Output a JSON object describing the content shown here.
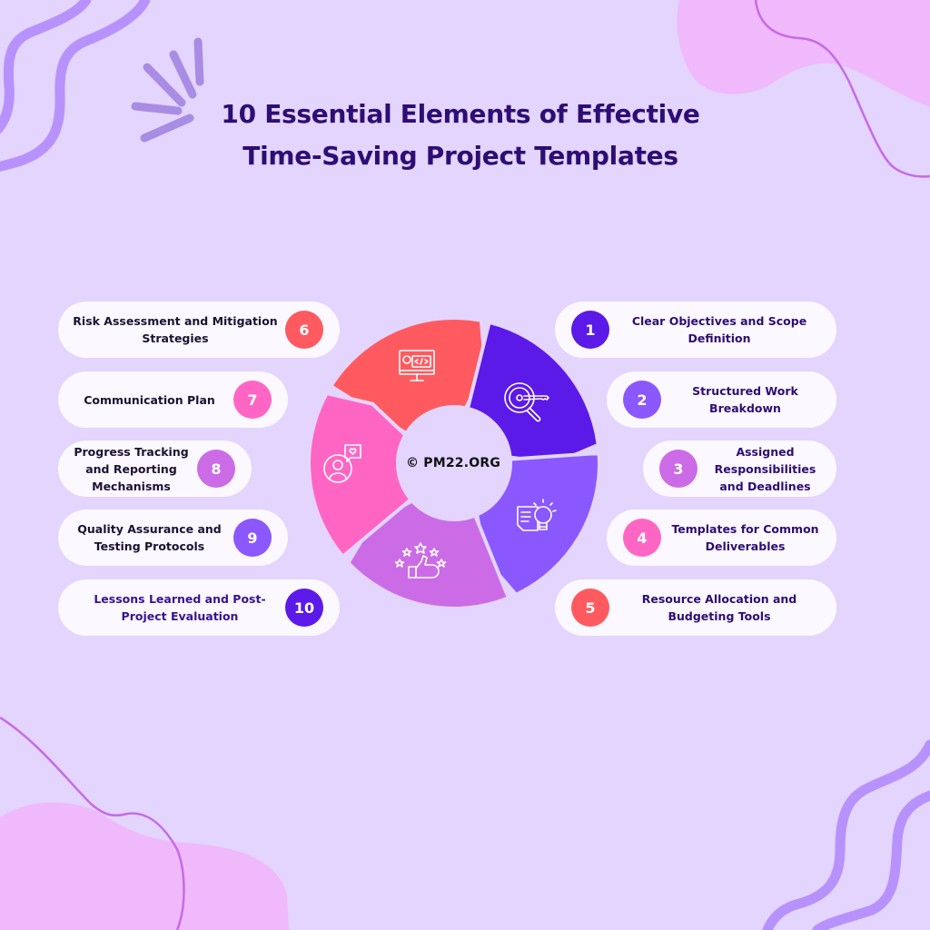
{
  "title": {
    "line1": "10 Essential Elements of Effective",
    "line2": "Time-Saving Project Templates"
  },
  "center_label": "© PM22.ORG",
  "colors": {
    "background": "#e3d5fd",
    "title": "#2e0d74",
    "card": "#fcf8ff",
    "red": "#ff5a5f",
    "indigo": "#5b1ae8",
    "violet": "#8b57fe",
    "orchid": "#cb6ce6",
    "pink": "#ff66c4"
  },
  "items": [
    {
      "number": "1",
      "text": "Clear Objectives and Scope Definition",
      "color": "#5b1ae8",
      "side": "right"
    },
    {
      "number": "2",
      "text": "Structured Work Breakdown",
      "color": "#8b57fe",
      "side": "right"
    },
    {
      "number": "3",
      "text": "Assigned Responsibilities and Deadlines",
      "color": "#cb6ce6",
      "side": "right"
    },
    {
      "number": "4",
      "text": "Templates for Common Deliverables",
      "color": "#ff66c4",
      "side": "right"
    },
    {
      "number": "5",
      "text": "Resource Allocation and Budgeting Tools",
      "color": "#ff5a5f",
      "side": "right"
    },
    {
      "number": "6",
      "text": "Risk Assessment and Mitigation Strategies",
      "color": "#ff5a5f",
      "side": "left"
    },
    {
      "number": "7",
      "text": "Communication Plan",
      "color": "#ff66c4",
      "side": "left"
    },
    {
      "number": "8",
      "text": "Progress Tracking and Reporting Mechanisms",
      "color": "#cb6ce6",
      "side": "left"
    },
    {
      "number": "9",
      "text": "Quality Assurance and Testing Protocols",
      "color": "#8b57fe",
      "side": "left"
    },
    {
      "number": "10",
      "text": "Lessons Learned and Post-Project Evaluation",
      "color": "#5b1ae8",
      "side": "left"
    }
  ],
  "segments": [
    {
      "name": "development",
      "icon": "computer-code-icon",
      "color": "#ff5a5f"
    },
    {
      "name": "key-search",
      "icon": "key-search-icon",
      "color": "#5b1ae8"
    },
    {
      "name": "idea",
      "icon": "lightbulb-document-icon",
      "color": "#8b57fe"
    },
    {
      "name": "rating",
      "icon": "thumbs-up-stars-icon",
      "color": "#cb6ce6"
    },
    {
      "name": "engagement",
      "icon": "user-heart-chat-icon",
      "color": "#ff66c4"
    }
  ]
}
